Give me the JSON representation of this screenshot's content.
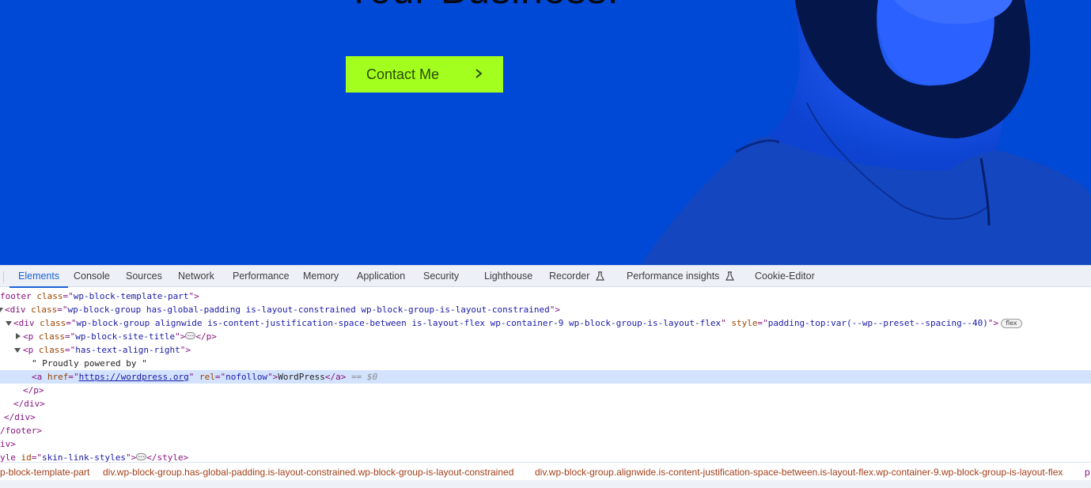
{
  "page": {
    "hero_heading": "Your Business.",
    "contact_button": "Contact Me",
    "colors": {
      "hero_background": "#0049d6",
      "button_background": "#a2ff1e",
      "button_text": "#2c4a06"
    }
  },
  "devtools": {
    "tabs": [
      {
        "label": "Elements",
        "active": true
      },
      {
        "label": "Console"
      },
      {
        "label": "Sources"
      },
      {
        "label": "Network"
      },
      {
        "label": "Performance"
      },
      {
        "label": "Memory"
      },
      {
        "label": "Application"
      },
      {
        "label": "Security"
      },
      {
        "label": "Lighthouse"
      },
      {
        "label": "Recorder",
        "icon": "flask-icon"
      },
      {
        "label": "Performance insights",
        "icon": "flask-icon"
      },
      {
        "label": "Cookie-Editor"
      }
    ],
    "dom": {
      "l0_tag": "footer",
      "l0_attr": "class",
      "l0_val": "wp-block-template-part",
      "l1_tag": "div",
      "l1_attr": "class",
      "l1_val": "wp-block-group has-global-padding is-layout-constrained wp-block-group-is-layout-constrained",
      "l2_tag": "div",
      "l2_attr": "class",
      "l2_val": "wp-block-group alignwide is-content-justification-space-between is-layout-flex wp-container-9 wp-block-group-is-layout-flex",
      "l2_attr2": "style",
      "l2_val2": "padding-top:var(--wp--preset--spacing--40)",
      "l2_badge": "flex",
      "l3_tag": "p",
      "l3_attr": "class",
      "l3_val": "wp-block-site-title",
      "l4_tag": "p",
      "l4_attr": "class",
      "l4_val": "has-text-align-right",
      "l5_text": "\" Proudly powered by \"",
      "l6_tag": "a",
      "l6_attr": "href",
      "l6_val": "https://wordpress.org",
      "l6_attr2": "rel",
      "l6_val2": "nofollow",
      "l6_text": "WordPress",
      "l6_ref": "== $0",
      "l7": "</p>",
      "l8": "</div>",
      "l9": "</div>",
      "l10": "/footer>",
      "l11": "iv>",
      "l12_tag": "yle",
      "l12_attr": "id",
      "l12_val": "skin-link-styles"
    },
    "breadcrumbs": [
      "p-block-template-part",
      "div.wp-block-group.has-global-padding.is-layout-constrained.wp-block-group-is-layout-constrained",
      "div.wp-block-group.alignwide.is-content-justification-space-between.is-layout-flex.wp-container-9.wp-block-group-is-layout-flex",
      "p"
    ]
  }
}
